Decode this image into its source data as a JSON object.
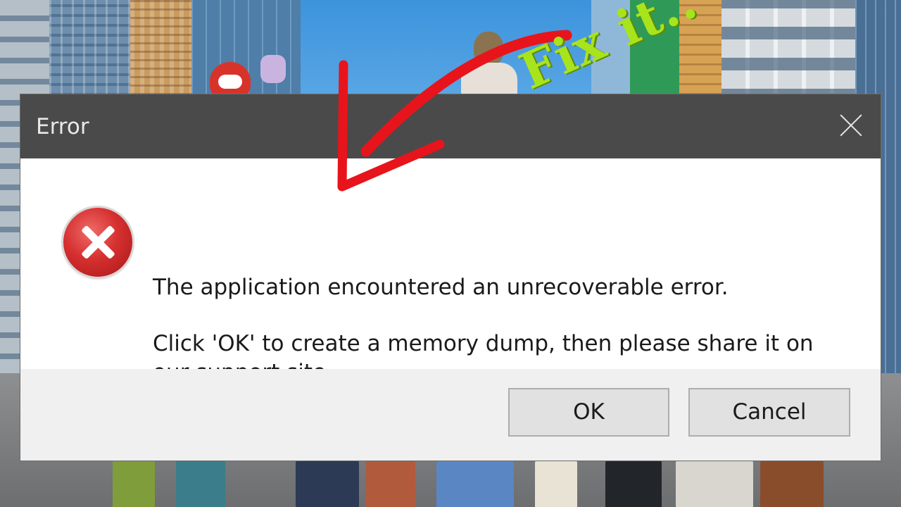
{
  "dialog": {
    "title": "Error",
    "icon": "error-x-icon",
    "message_line_1": "The application encountered an unrecoverable error.",
    "message_line_2": "Click 'OK' to create a memory dump, then please share it on our support site.",
    "ok_label": "OK",
    "cancel_label": "Cancel"
  },
  "overlay": {
    "caption": "Fix it..",
    "caption_color": "#a8e41b",
    "arrow_color": "#e8141b"
  },
  "colors": {
    "titlebar": "#4a4a4a",
    "footer": "#f0f0f0",
    "error_red": "#d5302f"
  }
}
